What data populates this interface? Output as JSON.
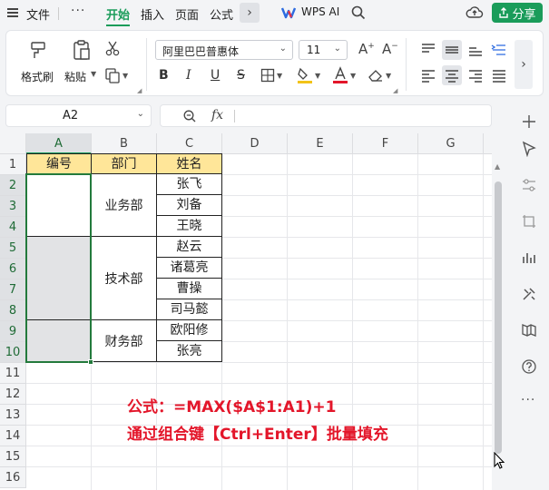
{
  "menu": {
    "file": "文件",
    "more_dots": "···",
    "tabs": [
      "开始",
      "插入",
      "页面",
      "公式"
    ],
    "active_tab": "开始",
    "more": "›",
    "wps_ai": "WPS AI",
    "share": "分享"
  },
  "ribbon": {
    "format_painter": "格式刷",
    "paste": "粘贴",
    "font_name": "阿里巴巴普惠体",
    "font_size": "11",
    "bold": "B",
    "italic": "I",
    "underline": "U",
    "strikethrough": "S",
    "grow_font": "A⁺",
    "shrink_font": "A⁻"
  },
  "formula_bar": {
    "cell_ref": "A2",
    "fx": "fx",
    "content": ""
  },
  "sheet": {
    "columns": [
      "A",
      "B",
      "C",
      "D",
      "E",
      "F",
      "G"
    ],
    "selected_column": "A",
    "rows": [
      "1",
      "2",
      "3",
      "4",
      "5",
      "6",
      "7",
      "8",
      "9",
      "10",
      "11",
      "12",
      "13",
      "14",
      "15",
      "16"
    ],
    "header_row": {
      "a": "编号",
      "b": "部门",
      "c": "姓名"
    },
    "departments": [
      "业务部",
      "技术部",
      "财务部"
    ],
    "names": [
      "张飞",
      "刘备",
      "王晓",
      "赵云",
      "诸葛亮",
      "曹操",
      "司马懿",
      "欧阳修",
      "张亮"
    ]
  },
  "annotation": {
    "line1": "公式：=MAX($A$1:A1)+1",
    "line2": "通过组合键【Ctrl+Enter】批量填充"
  },
  "colors": {
    "accent": "#1a9c5a",
    "header_fill": "#ffe699",
    "annotation_red": "#e3162a",
    "selection_border": "#237a3c"
  }
}
